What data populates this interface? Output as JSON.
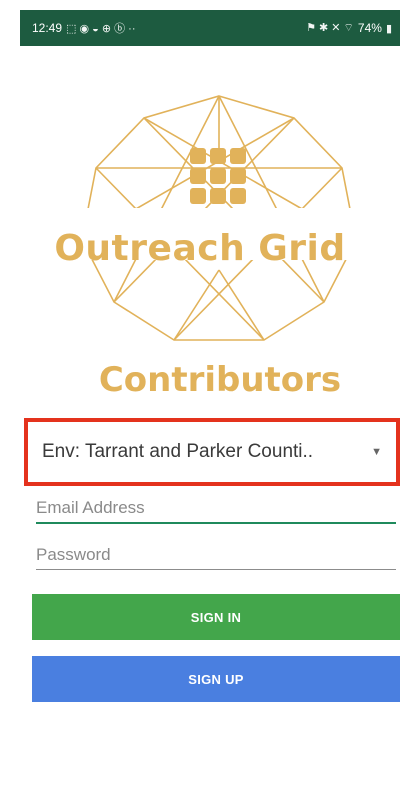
{
  "status_bar": {
    "time": "12:49",
    "left_icons": "⬚ ◉ ◒ ⊕ ⓑ ··",
    "right_icons": "⚑ ✱ ✕ ⌔",
    "battery_percent": "74%"
  },
  "logo": {
    "brand": "Outreach Grid",
    "subtitle": "Contributors",
    "accent_color": "#e1b25a"
  },
  "env_selector": {
    "selected": "Env: Tarrant and Parker Counti..",
    "highlight_color": "#e4321d"
  },
  "form": {
    "email_placeholder": "Email Address",
    "password_placeholder": "Password",
    "sign_in_label": "SIGN IN",
    "sign_up_label": "SIGN UP",
    "sign_in_color": "#43a64b",
    "sign_up_color": "#4a7fe0"
  }
}
